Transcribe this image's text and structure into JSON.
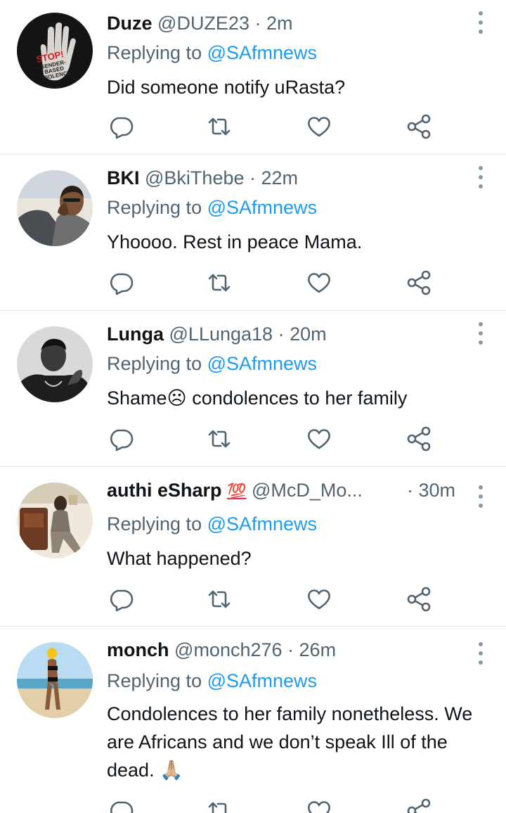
{
  "reply_prefix": "Replying to ",
  "tweets": [
    {
      "name": "Duze",
      "handle": "@DUZE23",
      "time": "· 2m",
      "reply_to": "@SAfmnews",
      "text": "Did someone notify uRasta?",
      "avatar_text": [
        "STOP!",
        "GENDER-",
        "BASED",
        "VIOLENCE"
      ]
    },
    {
      "name": "BKI",
      "handle": "@BkiThebe",
      "time": "· 22m",
      "reply_to": "@SAfmnews",
      "text": "Yhoooo. Rest in peace Mama."
    },
    {
      "name": "Lunga",
      "handle": "@LLunga18",
      "time": "· 20m",
      "reply_to": "@SAfmnews",
      "text": "Shame☹ condolences to her family"
    },
    {
      "name": "authi eSharp",
      "emoji": "💯",
      "handle": "@McD_Mo...",
      "time": "· 30m",
      "reply_to": "@SAfmnews",
      "text": "What happened?"
    },
    {
      "name": "monch",
      "handle": "@monch276",
      "time": "· 26m",
      "reply_to": "@SAfmnews",
      "text": "Condolences to her family nonetheless. We are Africans and we don’t speak Ill of the dead. 🙏🏼"
    }
  ],
  "icons": {
    "reply": "reply-icon",
    "retweet": "retweet-icon",
    "like": "heart-icon",
    "share": "share-icon",
    "more": "more-vertical-icon"
  },
  "colors": {
    "text": "#0f1419",
    "secondary": "#536471",
    "link": "#1d9bf0",
    "divider": "#e3e6e9"
  }
}
